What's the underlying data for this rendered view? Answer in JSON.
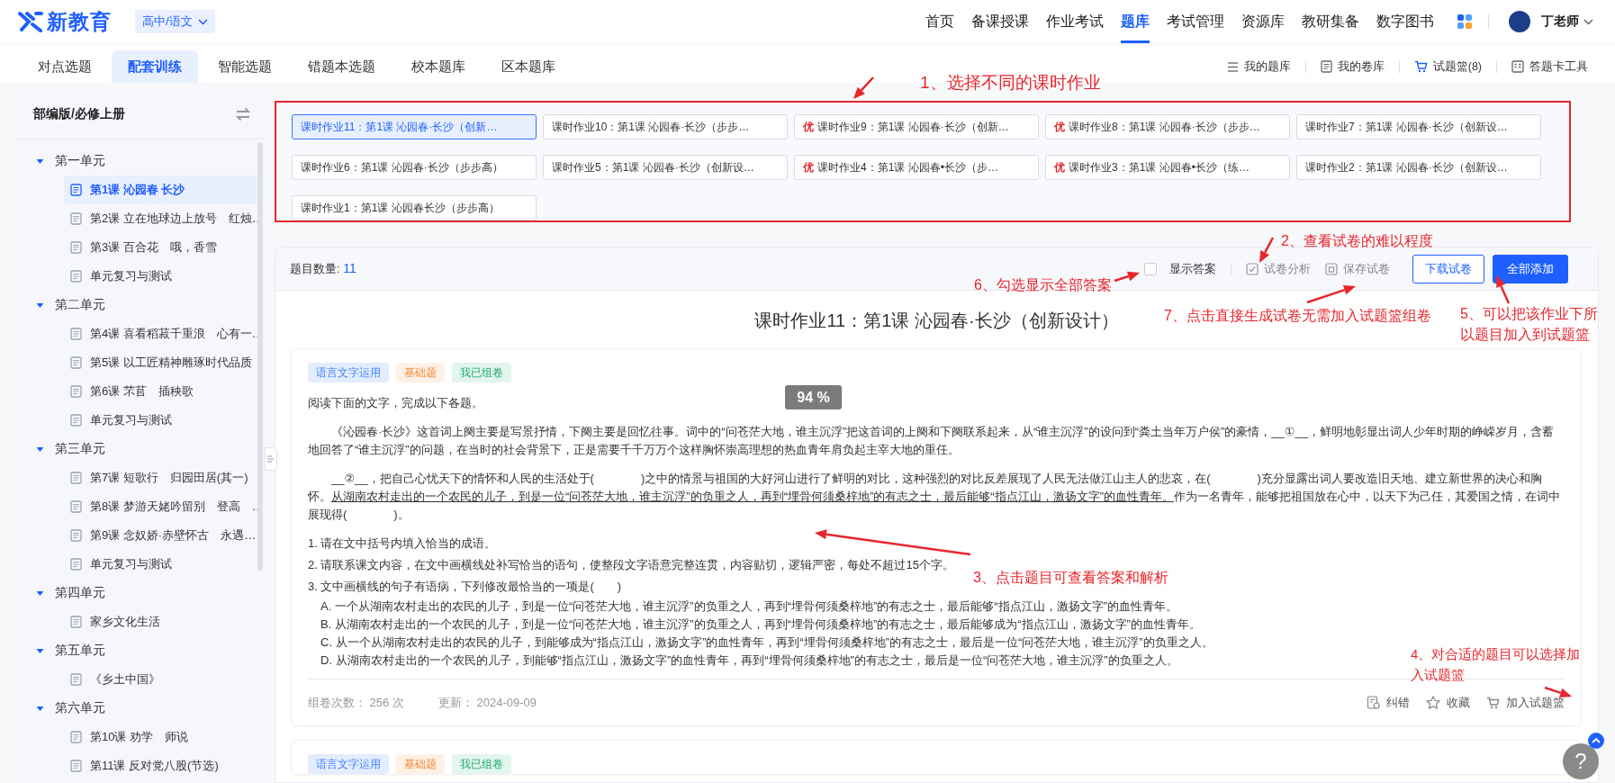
{
  "header": {
    "logo": "新教育",
    "grade_subject": "高中/语文",
    "nav": [
      {
        "label": "首页",
        "selected": false
      },
      {
        "label": "备课授课",
        "selected": false
      },
      {
        "label": "作业考试",
        "selected": false
      },
      {
        "label": "题库",
        "selected": true
      },
      {
        "label": "考试管理",
        "selected": false
      },
      {
        "label": "资源库",
        "selected": false
      },
      {
        "label": "教研集备",
        "selected": false
      },
      {
        "label": "数字图书",
        "selected": false
      }
    ],
    "user": "丁老师"
  },
  "tabs": [
    {
      "label": "对点选题",
      "selected": false
    },
    {
      "label": "配套训练",
      "selected": true
    },
    {
      "label": "智能选题",
      "selected": false
    },
    {
      "label": "错题本选题",
      "selected": false
    },
    {
      "label": "校本题库",
      "selected": false
    },
    {
      "label": "区本题库",
      "selected": false
    }
  ],
  "tools": [
    {
      "label": "我的题库"
    },
    {
      "label": "我的卷库"
    },
    {
      "label": "试题篮(8)"
    },
    {
      "label": "答题卡工具"
    }
  ],
  "sidebar": {
    "title": "部编版/必修上册",
    "units": [
      {
        "label": "第一单元",
        "expanded": true,
        "children": [
          {
            "label": "第1课 沁园春 长沙",
            "selected": true
          },
          {
            "label": "第2课 立在地球边上放号　红烛…",
            "selected": false
          },
          {
            "label": "第3课 百合花　哦，香雪",
            "selected": false
          },
          {
            "label": "单元复习与测试",
            "selected": false
          }
        ]
      },
      {
        "label": "第二单元",
        "expanded": true,
        "children": [
          {
            "label": "第4课 喜看稻菽千重浪　心有一…",
            "selected": false
          },
          {
            "label": "第5课 以工匠精神雕琢时代品质",
            "selected": false
          },
          {
            "label": "第6课 芣苢　插秧歌",
            "selected": false
          },
          {
            "label": "单元复习与测试",
            "selected": false
          }
        ]
      },
      {
        "label": "第三单元",
        "expanded": true,
        "children": [
          {
            "label": "第7课 短歌行　归园田居(其一)",
            "selected": false
          },
          {
            "label": "第8课 梦游天姥吟留别　登高　…",
            "selected": false
          },
          {
            "label": "第9课 念奴娇·赤壁怀古　永遇…",
            "selected": false
          },
          {
            "label": "单元复习与测试",
            "selected": false
          }
        ]
      },
      {
        "label": "第四单元",
        "expanded": true,
        "children": [
          {
            "label": "家乡文化生活",
            "selected": false
          }
        ]
      },
      {
        "label": "第五单元",
        "expanded": true,
        "children": [
          {
            "label": "《乡土中国》",
            "selected": false
          }
        ]
      },
      {
        "label": "第六单元",
        "expanded": true,
        "children": [
          {
            "label": "第10课 劝学　师说",
            "selected": false
          },
          {
            "label": "第11课 反对党八股(节选)",
            "selected": false
          }
        ]
      }
    ]
  },
  "assignments": [
    {
      "label": "课时作业11：第1课 沁园春·长沙（创新…",
      "selected": true
    },
    {
      "label": "课时作业10：第1课 沁园春·长沙（步步…",
      "selected": false
    },
    {
      "label": "课时作业9：第1课 沁园春·长沙（创新…",
      "selected": false,
      "badge": "优"
    },
    {
      "label": "课时作业8：第1课 沁园春·长沙（步步…",
      "selected": false,
      "badge": "优"
    },
    {
      "label": "课时作业7：第1课 沁园春·长沙（创新设…",
      "selected": false
    },
    {
      "label": "课时作业6：第1课 沁园春·长沙（步步高）",
      "selected": false
    },
    {
      "label": "课时作业5：第1课 沁园春·长沙（创新设…",
      "selected": false
    },
    {
      "label": "课时作业4：第1课 沁园春•长沙（步…",
      "selected": false,
      "badge": "优"
    },
    {
      "label": "课时作业3：第1课 沁园春•长沙（练…",
      "selected": false,
      "badge": "优"
    },
    {
      "label": "课时作业2：第1课 沁园春·长沙（创新设…",
      "selected": false
    },
    {
      "label": "课时作业1：第1课 沁园春长沙（步步高）",
      "selected": false
    }
  ],
  "toolbar": {
    "count_label": "题目数量:",
    "count": "11",
    "show_answers": {
      "label": "显示答案",
      "checked": false
    },
    "actions": [
      {
        "label": "试卷分析"
      },
      {
        "label": "保存试卷"
      }
    ],
    "buttons": [
      {
        "label": "下载试卷",
        "kind": "outline"
      },
      {
        "label": "全部添加",
        "kind": "primary"
      }
    ]
  },
  "paper_title": "课时作业11：第1课 沁园春·长沙（创新设计）",
  "questions": [
    {
      "tags": [
        {
          "label": "语言文字运用",
          "kind": "topic"
        },
        {
          "label": "基础题",
          "kind": "difficulty"
        },
        {
          "label": "我已组卷",
          "kind": "status"
        }
      ],
      "intro": "阅读下面的文字，完成以下各题。",
      "paragraphs": [
        [
          {
            "text": "《沁园春·长沙》这首词上阕主要是写景抒情，下阕主要是回忆往事。词中的“问苍茫大地，谁主沉浮”把这首词的上阕和下阕联系起来，从“谁主沉浮”的设问到“粪土当年万户侯”的豪情，__①__，鲜明地彰显出词人少年时期的峥嵘岁月，含蓄地回答了“谁主沉浮”的问题，在当时的社会背景下，正是需要千千万万个这样胸怀崇高理想的热血青年肩负起主宰大地的重任。",
            "underline": false
          }
        ],
        [
          {
            "text": "__②__，把自己心忧天下的情怀和人民的生活处于(　　　　)之中的情景与祖国的大好河山进行了鲜明的对比，这种强烈的对比反差展现了人民无法做江山主人的悲哀，在(　　　　)充分显露出词人要改造旧天地、建立新世界的决心和胸怀。",
            "underline": false
          },
          {
            "text": "从湖南农村走出的一个农民的儿子，到是一位“问苍茫大地，谁主沉浮”的负重之人，再到“埋骨何须桑梓地”的有志之士，最后能够“指点江山，激扬文字”的血性青年。",
            "underline": true
          },
          {
            "text": "作为一名青年，能够把祖国放在心中，以天下为己任，其爱国之情，在词中展现得(　　　　)。",
            "underline": false
          }
        ]
      ],
      "subquestions": [
        "1. 请在文中括号内填入恰当的成语。",
        "2. 请联系课文内容，在文中画横线处补写恰当的语句，使整段文字语意完整连贯，内容贴切，逻辑严密，每处不超过15个字。",
        "3. 文中画横线的句子有语病，下列修改最恰当的一项是(　　)"
      ],
      "choices": [
        "A. 一个从湖南农村走出的农民的儿子，到是一位“问苍茫大地，谁主沉浮”的负重之人，再到“埋骨何须桑梓地”的有志之士，最后能够“指点江山，激扬文字”的血性青年。",
        "B. 从湖南农村走出的一个农民的儿子，到是一位“问苍茫大地，谁主沉浮”的负重之人，再到“埋骨何须桑梓地”的有志之士，最后能够成为“指点江山，激扬文字”的血性青年。",
        "C. 从一个从湖南农村走出的农民的儿子，到能够成为“指点江山，激扬文字”的血性青年，再到“埋骨何须桑梓地”的有志之士，最后是一位“问苍茫大地，谁主沉浮”的负重之人。",
        "D. 从湖南农村走出的一个农民的儿子，到能够“指点江山，激扬文字”的血性青年，再到“埋骨何须桑梓地”的有志之士，最后是一位“问苍茫大地，谁主沉浮”的负重之人。"
      ],
      "stats": [
        "组卷次数： 256 次",
        "更新： 2024-09-09"
      ],
      "actions": [
        {
          "label": "纠错"
        },
        {
          "label": "收藏"
        },
        {
          "label": "加入试题篮"
        }
      ]
    },
    {
      "tags": [
        {
          "label": "语言文字运用",
          "kind": "topic"
        },
        {
          "label": "基础题",
          "kind": "difficulty"
        },
        {
          "label": "我已组卷",
          "kind": "status"
        }
      ]
    }
  ],
  "overlay_badge": "94 %",
  "annotations": [
    {
      "text": "1、选择不同的课时作业"
    },
    {
      "text": "2、查看试卷的难以程度"
    },
    {
      "text": "6、勾选显示全部答案"
    },
    {
      "text": "7、点击直接生成试卷无需加入试题篮组卷"
    },
    {
      "text": "5、可以把该作业下所以题目加入到试题篮"
    },
    {
      "text": "3、点击题目可查看答案和解析"
    },
    {
      "text": "4、对合适的题目可以选择加入试题篮"
    }
  ],
  "help": "?"
}
